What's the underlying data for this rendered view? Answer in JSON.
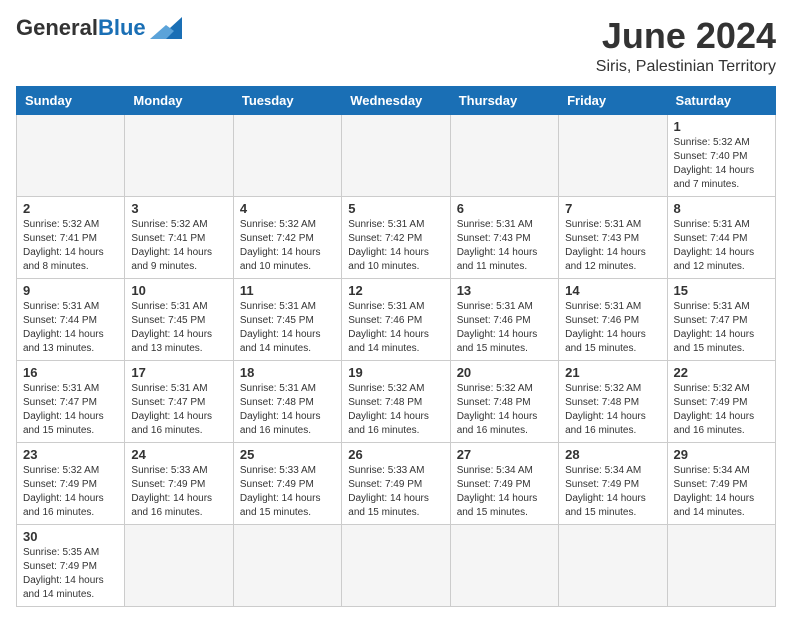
{
  "header": {
    "logo_general": "General",
    "logo_blue": "Blue",
    "month_title": "June 2024",
    "subtitle": "Siris, Palestinian Territory"
  },
  "weekdays": [
    "Sunday",
    "Monday",
    "Tuesday",
    "Wednesday",
    "Thursday",
    "Friday",
    "Saturday"
  ],
  "weeks": [
    [
      {
        "day": "",
        "empty": true
      },
      {
        "day": "",
        "empty": true
      },
      {
        "day": "",
        "empty": true
      },
      {
        "day": "",
        "empty": true
      },
      {
        "day": "",
        "empty": true
      },
      {
        "day": "",
        "empty": true
      },
      {
        "day": "1",
        "sunrise": "Sunrise: 5:32 AM",
        "sunset": "Sunset: 7:40 PM",
        "daylight": "Daylight: 14 hours and 7 minutes."
      }
    ],
    [
      {
        "day": "2",
        "sunrise": "Sunrise: 5:32 AM",
        "sunset": "Sunset: 7:41 PM",
        "daylight": "Daylight: 14 hours and 8 minutes."
      },
      {
        "day": "3",
        "sunrise": "Sunrise: 5:32 AM",
        "sunset": "Sunset: 7:41 PM",
        "daylight": "Daylight: 14 hours and 9 minutes."
      },
      {
        "day": "4",
        "sunrise": "Sunrise: 5:32 AM",
        "sunset": "Sunset: 7:42 PM",
        "daylight": "Daylight: 14 hours and 10 minutes."
      },
      {
        "day": "5",
        "sunrise": "Sunrise: 5:31 AM",
        "sunset": "Sunset: 7:42 PM",
        "daylight": "Daylight: 14 hours and 10 minutes."
      },
      {
        "day": "6",
        "sunrise": "Sunrise: 5:31 AM",
        "sunset": "Sunset: 7:43 PM",
        "daylight": "Daylight: 14 hours and 11 minutes."
      },
      {
        "day": "7",
        "sunrise": "Sunrise: 5:31 AM",
        "sunset": "Sunset: 7:43 PM",
        "daylight": "Daylight: 14 hours and 12 minutes."
      },
      {
        "day": "8",
        "sunrise": "Sunrise: 5:31 AM",
        "sunset": "Sunset: 7:44 PM",
        "daylight": "Daylight: 14 hours and 12 minutes."
      }
    ],
    [
      {
        "day": "9",
        "sunrise": "Sunrise: 5:31 AM",
        "sunset": "Sunset: 7:44 PM",
        "daylight": "Daylight: 14 hours and 13 minutes."
      },
      {
        "day": "10",
        "sunrise": "Sunrise: 5:31 AM",
        "sunset": "Sunset: 7:45 PM",
        "daylight": "Daylight: 14 hours and 13 minutes."
      },
      {
        "day": "11",
        "sunrise": "Sunrise: 5:31 AM",
        "sunset": "Sunset: 7:45 PM",
        "daylight": "Daylight: 14 hours and 14 minutes."
      },
      {
        "day": "12",
        "sunrise": "Sunrise: 5:31 AM",
        "sunset": "Sunset: 7:46 PM",
        "daylight": "Daylight: 14 hours and 14 minutes."
      },
      {
        "day": "13",
        "sunrise": "Sunrise: 5:31 AM",
        "sunset": "Sunset: 7:46 PM",
        "daylight": "Daylight: 14 hours and 15 minutes."
      },
      {
        "day": "14",
        "sunrise": "Sunrise: 5:31 AM",
        "sunset": "Sunset: 7:46 PM",
        "daylight": "Daylight: 14 hours and 15 minutes."
      },
      {
        "day": "15",
        "sunrise": "Sunrise: 5:31 AM",
        "sunset": "Sunset: 7:47 PM",
        "daylight": "Daylight: 14 hours and 15 minutes."
      }
    ],
    [
      {
        "day": "16",
        "sunrise": "Sunrise: 5:31 AM",
        "sunset": "Sunset: 7:47 PM",
        "daylight": "Daylight: 14 hours and 15 minutes."
      },
      {
        "day": "17",
        "sunrise": "Sunrise: 5:31 AM",
        "sunset": "Sunset: 7:47 PM",
        "daylight": "Daylight: 14 hours and 16 minutes."
      },
      {
        "day": "18",
        "sunrise": "Sunrise: 5:31 AM",
        "sunset": "Sunset: 7:48 PM",
        "daylight": "Daylight: 14 hours and 16 minutes."
      },
      {
        "day": "19",
        "sunrise": "Sunrise: 5:32 AM",
        "sunset": "Sunset: 7:48 PM",
        "daylight": "Daylight: 14 hours and 16 minutes."
      },
      {
        "day": "20",
        "sunrise": "Sunrise: 5:32 AM",
        "sunset": "Sunset: 7:48 PM",
        "daylight": "Daylight: 14 hours and 16 minutes."
      },
      {
        "day": "21",
        "sunrise": "Sunrise: 5:32 AM",
        "sunset": "Sunset: 7:48 PM",
        "daylight": "Daylight: 14 hours and 16 minutes."
      },
      {
        "day": "22",
        "sunrise": "Sunrise: 5:32 AM",
        "sunset": "Sunset: 7:49 PM",
        "daylight": "Daylight: 14 hours and 16 minutes."
      }
    ],
    [
      {
        "day": "23",
        "sunrise": "Sunrise: 5:32 AM",
        "sunset": "Sunset: 7:49 PM",
        "daylight": "Daylight: 14 hours and 16 minutes."
      },
      {
        "day": "24",
        "sunrise": "Sunrise: 5:33 AM",
        "sunset": "Sunset: 7:49 PM",
        "daylight": "Daylight: 14 hours and 16 minutes."
      },
      {
        "day": "25",
        "sunrise": "Sunrise: 5:33 AM",
        "sunset": "Sunset: 7:49 PM",
        "daylight": "Daylight: 14 hours and 15 minutes."
      },
      {
        "day": "26",
        "sunrise": "Sunrise: 5:33 AM",
        "sunset": "Sunset: 7:49 PM",
        "daylight": "Daylight: 14 hours and 15 minutes."
      },
      {
        "day": "27",
        "sunrise": "Sunrise: 5:34 AM",
        "sunset": "Sunset: 7:49 PM",
        "daylight": "Daylight: 14 hours and 15 minutes."
      },
      {
        "day": "28",
        "sunrise": "Sunrise: 5:34 AM",
        "sunset": "Sunset: 7:49 PM",
        "daylight": "Daylight: 14 hours and 15 minutes."
      },
      {
        "day": "29",
        "sunrise": "Sunrise: 5:34 AM",
        "sunset": "Sunset: 7:49 PM",
        "daylight": "Daylight: 14 hours and 14 minutes."
      }
    ],
    [
      {
        "day": "30",
        "sunrise": "Sunrise: 5:35 AM",
        "sunset": "Sunset: 7:49 PM",
        "daylight": "Daylight: 14 hours and 14 minutes."
      },
      {
        "day": "",
        "empty": true
      },
      {
        "day": "",
        "empty": true
      },
      {
        "day": "",
        "empty": true
      },
      {
        "day": "",
        "empty": true
      },
      {
        "day": "",
        "empty": true
      },
      {
        "day": "",
        "empty": true
      }
    ]
  ]
}
